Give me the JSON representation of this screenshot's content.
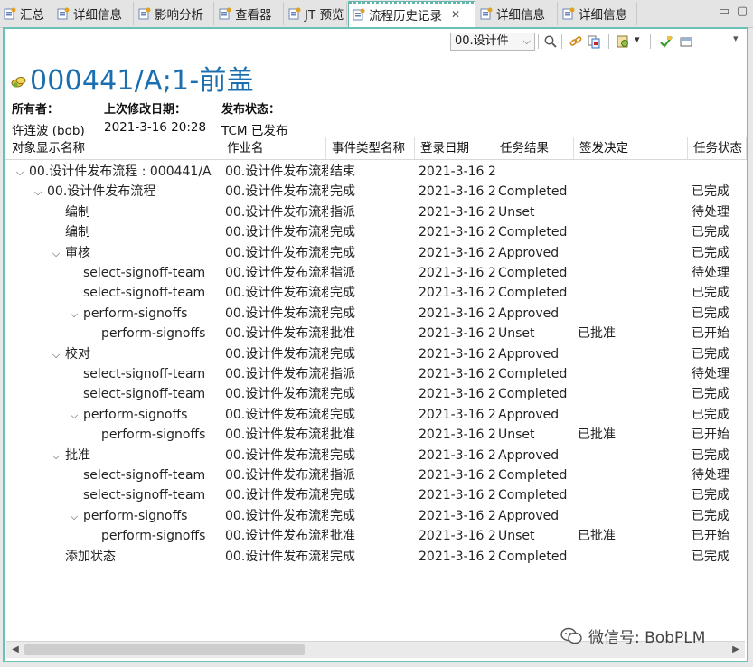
{
  "tabs": [
    {
      "label": "汇总",
      "icon": "summary-icon"
    },
    {
      "label": "详细信息",
      "icon": "details-icon"
    },
    {
      "label": "影响分析",
      "icon": "impact-icon"
    },
    {
      "label": "查看器",
      "icon": "viewer-icon"
    },
    {
      "label": "JT 预览",
      "icon": "jt-icon"
    },
    {
      "label": "流程历史记录",
      "icon": "process-history-icon",
      "active": true,
      "close": "✕"
    },
    {
      "label": "详细信息",
      "icon": "details-icon"
    },
    {
      "label": "详细信息",
      "icon": "details-icon"
    }
  ],
  "window_controls": {
    "minimize": "▭",
    "maximize": "▢"
  },
  "toolbar": {
    "dropdown_value": "00.设计件",
    "dropdown_caret": "⌵",
    "menu_caret": "▾",
    "icons": [
      "search-icon",
      "link-icon",
      "copy-icon",
      "settings-icon",
      "check-icon",
      "print-icon"
    ]
  },
  "object": {
    "title": "000441/A;1-前盖",
    "props": {
      "owner_label": "所有者：",
      "owner_value": "许连波 (bob)",
      "modified_label": "上次修改日期：",
      "modified_value": "2021-3-16 20:28",
      "status_label": "发布状态：",
      "status_value": "TCM 已发布"
    }
  },
  "table": {
    "columns": [
      "对象显示名称",
      "作业名",
      "事件类型名称",
      "登录日期",
      "任务结果",
      "签发决定",
      "任务状态"
    ],
    "rows": [
      {
        "indent": 0,
        "toggle": "v",
        "name": "00.设计件发布流程 : 000441/A",
        "job": "00.设计件发布流程",
        "event": "结束",
        "date": "2021-3-16 2",
        "result": "",
        "decision": "",
        "state": ""
      },
      {
        "indent": 1,
        "toggle": "v",
        "name": "00.设计件发布流程",
        "job": "00.设计件发布流程",
        "event": "完成",
        "date": "2021-3-16 2",
        "result": "Completed",
        "decision": "",
        "state": "已完成"
      },
      {
        "indent": 2,
        "toggle": "",
        "name": "编制",
        "job": "00.设计件发布流程",
        "event": "指派",
        "date": "2021-3-16 2",
        "result": "Unset",
        "decision": "",
        "state": "待处理"
      },
      {
        "indent": 2,
        "toggle": "",
        "name": "编制",
        "job": "00.设计件发布流程",
        "event": "完成",
        "date": "2021-3-16 2",
        "result": "Completed",
        "decision": "",
        "state": "已完成"
      },
      {
        "indent": 2,
        "toggle": "v",
        "name": "审核",
        "job": "00.设计件发布流程",
        "event": "完成",
        "date": "2021-3-16 2",
        "result": "Approved",
        "decision": "",
        "state": "已完成"
      },
      {
        "indent": 3,
        "toggle": "",
        "name": "select-signoff-team",
        "job": "00.设计件发布流程",
        "event": "指派",
        "date": "2021-3-16 2",
        "result": "Completed",
        "decision": "",
        "state": "待处理"
      },
      {
        "indent": 3,
        "toggle": "",
        "name": "select-signoff-team",
        "job": "00.设计件发布流程",
        "event": "完成",
        "date": "2021-3-16 2",
        "result": "Completed",
        "decision": "",
        "state": "已完成"
      },
      {
        "indent": 3,
        "toggle": "v",
        "name": "perform-signoffs",
        "job": "00.设计件发布流程",
        "event": "完成",
        "date": "2021-3-16 2",
        "result": "Approved",
        "decision": "",
        "state": "已完成"
      },
      {
        "indent": 4,
        "toggle": "",
        "name": "perform-signoffs",
        "job": "00.设计件发布流程",
        "event": "批准",
        "date": "2021-3-16 2",
        "result": "Unset",
        "decision": "已批准",
        "state": "已开始"
      },
      {
        "indent": 2,
        "toggle": "v",
        "name": "校对",
        "job": "00.设计件发布流程",
        "event": "完成",
        "date": "2021-3-16 2",
        "result": "Approved",
        "decision": "",
        "state": "已完成"
      },
      {
        "indent": 3,
        "toggle": "",
        "name": "select-signoff-team",
        "job": "00.设计件发布流程",
        "event": "指派",
        "date": "2021-3-16 2",
        "result": "Completed",
        "decision": "",
        "state": "待处理"
      },
      {
        "indent": 3,
        "toggle": "",
        "name": "select-signoff-team",
        "job": "00.设计件发布流程",
        "event": "完成",
        "date": "2021-3-16 2",
        "result": "Completed",
        "decision": "",
        "state": "已完成"
      },
      {
        "indent": 3,
        "toggle": "v",
        "name": "perform-signoffs",
        "job": "00.设计件发布流程",
        "event": "完成",
        "date": "2021-3-16 2",
        "result": "Approved",
        "decision": "",
        "state": "已完成"
      },
      {
        "indent": 4,
        "toggle": "",
        "name": "perform-signoffs",
        "job": "00.设计件发布流程",
        "event": "批准",
        "date": "2021-3-16 2",
        "result": "Unset",
        "decision": "已批准",
        "state": "已开始"
      },
      {
        "indent": 2,
        "toggle": "v",
        "name": "批准",
        "job": "00.设计件发布流程",
        "event": "完成",
        "date": "2021-3-16 2",
        "result": "Approved",
        "decision": "",
        "state": "已完成"
      },
      {
        "indent": 3,
        "toggle": "",
        "name": "select-signoff-team",
        "job": "00.设计件发布流程",
        "event": "指派",
        "date": "2021-3-16 2",
        "result": "Completed",
        "decision": "",
        "state": "待处理"
      },
      {
        "indent": 3,
        "toggle": "",
        "name": "select-signoff-team",
        "job": "00.设计件发布流程",
        "event": "完成",
        "date": "2021-3-16 2",
        "result": "Completed",
        "decision": "",
        "state": "已完成"
      },
      {
        "indent": 3,
        "toggle": "v",
        "name": "perform-signoffs",
        "job": "00.设计件发布流程",
        "event": "完成",
        "date": "2021-3-16 2",
        "result": "Approved",
        "decision": "",
        "state": "已完成"
      },
      {
        "indent": 4,
        "toggle": "",
        "name": "perform-signoffs",
        "job": "00.设计件发布流程",
        "event": "批准",
        "date": "2021-3-16 2",
        "result": "Unset",
        "decision": "已批准",
        "state": "已开始"
      },
      {
        "indent": 2,
        "toggle": "",
        "name": "添加状态",
        "job": "00.设计件发布流程",
        "event": "完成",
        "date": "2021-3-16 2",
        "result": "Completed",
        "decision": "",
        "state": "已完成"
      }
    ]
  },
  "scrollbar": {
    "left_arrow": "◀",
    "right_arrow": "▶"
  },
  "watermark": {
    "text": "微信号: BobPLM",
    "icon": "wechat-icon"
  },
  "colors": {
    "accent": "#6cc0b6",
    "title": "#1b6fb0"
  }
}
